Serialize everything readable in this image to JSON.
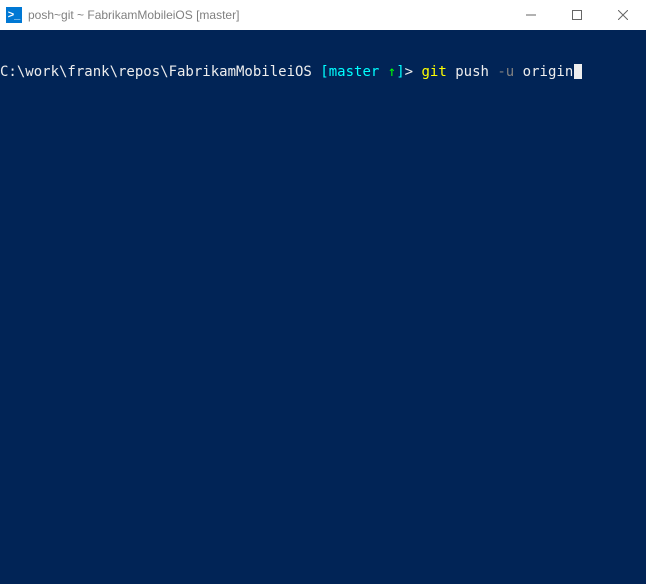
{
  "titlebar": {
    "icon_glyph": ">_",
    "title": "posh~git ~ FabrikamMobileiOS [master]"
  },
  "prompt": {
    "path": "C:\\work\\frank\\repos\\FabrikamMobileiOS ",
    "branch_open": "[",
    "branch_name": "master ",
    "branch_arrow": "↑",
    "branch_close": "]",
    "prompt_char": "> ",
    "cmd": "git",
    "sp1": " ",
    "arg1": "push ",
    "flag": "-u",
    "sp2": " ",
    "arg2": "origin"
  }
}
